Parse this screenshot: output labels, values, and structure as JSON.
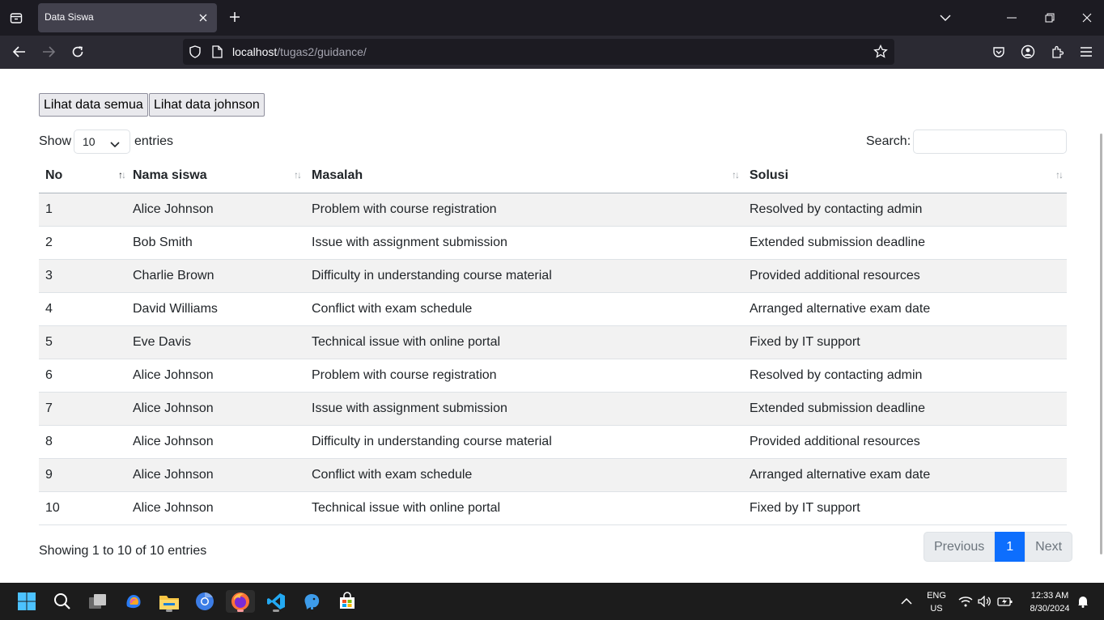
{
  "browser": {
    "tab_title": "Data Siswa",
    "url_host": "localhost",
    "url_path": "/tugas2/guidance/"
  },
  "page": {
    "buttons": [
      "Lihat data semua",
      "Lihat data johnson"
    ],
    "show_label": "Show",
    "entries_select_value": "10",
    "entries_label": "entries",
    "search_label": "Search:",
    "search_value": "",
    "columns": [
      "No",
      "Nama siswa",
      "Masalah",
      "Solusi"
    ],
    "rows": [
      [
        "1",
        "Alice Johnson",
        "Problem with course registration",
        "Resolved by contacting admin"
      ],
      [
        "2",
        "Bob Smith",
        "Issue with assignment submission",
        "Extended submission deadline"
      ],
      [
        "3",
        "Charlie Brown",
        "Difficulty in understanding course material",
        "Provided additional resources"
      ],
      [
        "4",
        "David Williams",
        "Conflict with exam schedule",
        "Arranged alternative exam date"
      ],
      [
        "5",
        "Eve Davis",
        "Technical issue with online portal",
        "Fixed by IT support"
      ],
      [
        "6",
        "Alice Johnson",
        "Problem with course registration",
        "Resolved by contacting admin"
      ],
      [
        "7",
        "Alice Johnson",
        "Issue with assignment submission",
        "Extended submission deadline"
      ],
      [
        "8",
        "Alice Johnson",
        "Difficulty in understanding course material",
        "Provided additional resources"
      ],
      [
        "9",
        "Alice Johnson",
        "Conflict with exam schedule",
        "Arranged alternative exam date"
      ],
      [
        "10",
        "Alice Johnson",
        "Technical issue with online portal",
        "Fixed by IT support"
      ]
    ],
    "info": "Showing 1 to 10 of 10 entries",
    "pager": {
      "prev": "Previous",
      "current": "1",
      "next": "Next"
    }
  },
  "taskbar": {
    "lang": "ENG",
    "region": "US",
    "time": "12:33 AM",
    "date": "8/30/2024"
  },
  "colors": {
    "accent": "#0d6efd",
    "chrome_dark": "#1c1b22",
    "chrome_nav": "#2b2a33",
    "stripe": "#f2f2f2"
  }
}
